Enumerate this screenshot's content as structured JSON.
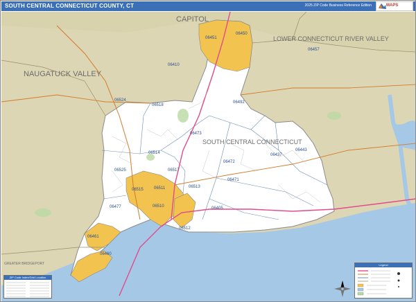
{
  "header": {
    "title": "SOUTH CENTRAL CONNECTICUT COUNTY, CT",
    "edition": "2025 ZIP Code Business Reference Edition"
  },
  "regions": {
    "capitol": "CAPITOL",
    "lower_ct_river": "LOWER CONNECTICUT RIVER VALLEY",
    "naugatuck": "NAUGATUCK VALLEY",
    "south_central": "SOUTH CENTRAL CONNECTICUT",
    "greater_bridgeport": "GREATER BRIDGEPORT"
  },
  "zip_codes": {
    "z06451": "06451",
    "z06450": "06450",
    "z06457": "06457",
    "z06410": "06410",
    "z06524": "06524",
    "z06518": "06518",
    "z06492": "06492",
    "z06473": "06473",
    "z06514": "06514",
    "z06437": "06437",
    "z06443": "06443",
    "z06472": "06472",
    "z06525": "06525",
    "z06517": "06517",
    "z06471": "06471",
    "z06513": "06513",
    "z06515": "06515",
    "z06511": "06511",
    "z06510": "06510",
    "z06477": "06477",
    "z06405": "06405",
    "z06512": "06512",
    "z06461": "06461",
    "z06460": "06460"
  },
  "legend": {
    "title": "Legend"
  },
  "index_table": {
    "title": "ZIP Code Index/Grid Location"
  },
  "colors": {
    "title_bar": "#3b6fb6",
    "county_fill": "#ffffff",
    "urban_fill": "#f2c34f",
    "surrounding_land": "#ddd6b4",
    "water": "#a5c8e6",
    "zip_label": "#2a4f8f",
    "region_label": "#6b6b6b"
  }
}
